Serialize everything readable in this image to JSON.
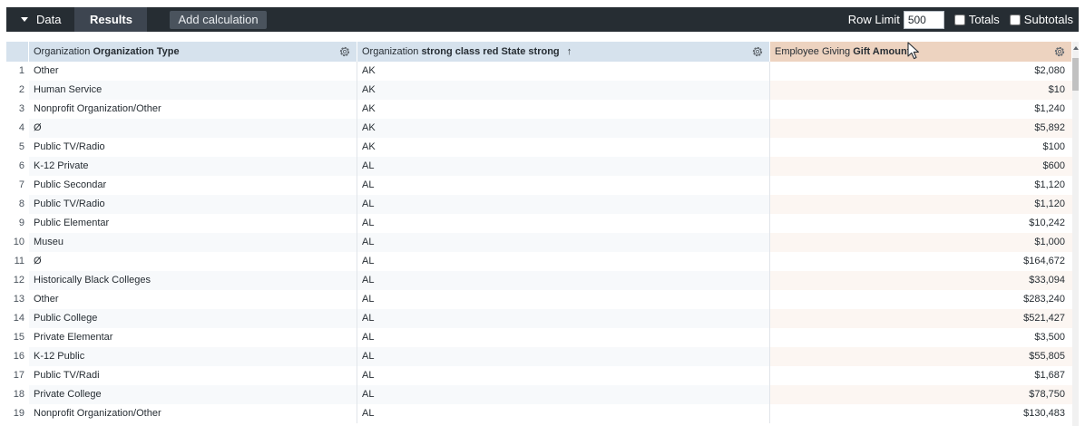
{
  "toolbar": {
    "data_tab": "Data",
    "results_tab": "Results",
    "add_calculation": "Add calculation",
    "row_limit_label": "Row Limit",
    "row_limit_value": "500",
    "totals_label": "Totals",
    "subtotals_label": "Subtotals"
  },
  "columns": {
    "col1": {
      "group": "Organization",
      "field": "Organization Type"
    },
    "col2": {
      "group": "Organization",
      "field": "strong class red State strong",
      "sort": "↑"
    },
    "col3": {
      "group": "Employee Giving",
      "field": "Gift Amount"
    }
  },
  "rows": [
    {
      "idx": "1",
      "type": "Other",
      "state": "AK",
      "amount": "$2,080"
    },
    {
      "idx": "2",
      "type": "Human Service",
      "state": "AK",
      "amount": "$10"
    },
    {
      "idx": "3",
      "type": "Nonprofit Organization/Other",
      "state": "AK",
      "amount": "$1,240"
    },
    {
      "idx": "4",
      "type": "Ø",
      "state": "AK",
      "amount": "$5,892"
    },
    {
      "idx": "5",
      "type": "Public TV/Radio",
      "state": "AK",
      "amount": "$100"
    },
    {
      "idx": "6",
      "type": "K-12 Private",
      "state": "AL",
      "amount": "$600"
    },
    {
      "idx": "7",
      "type": "Public Secondar",
      "state": "AL",
      "amount": "$1,120"
    },
    {
      "idx": "8",
      "type": "Public TV/Radio",
      "state": "AL",
      "amount": "$1,120"
    },
    {
      "idx": "9",
      "type": "Public Elementar",
      "state": "AL",
      "amount": "$10,242"
    },
    {
      "idx": "10",
      "type": "Museu",
      "state": "AL",
      "amount": "$1,000"
    },
    {
      "idx": "11",
      "type": "Ø",
      "state": "AL",
      "amount": "$164,672"
    },
    {
      "idx": "12",
      "type": "Historically Black Colleges",
      "state": "AL",
      "amount": "$33,094"
    },
    {
      "idx": "13",
      "type": "Other",
      "state": "AL",
      "amount": "$283,240"
    },
    {
      "idx": "14",
      "type": "Public College",
      "state": "AL",
      "amount": "$521,427"
    },
    {
      "idx": "15",
      "type": "Private Elementar",
      "state": "AL",
      "amount": "$3,500"
    },
    {
      "idx": "16",
      "type": "K-12 Public",
      "state": "AL",
      "amount": "$55,805"
    },
    {
      "idx": "17",
      "type": "Public TV/Radi",
      "state": "AL",
      "amount": "$1,687"
    },
    {
      "idx": "18",
      "type": "Private College",
      "state": "AL",
      "amount": "$78,750"
    },
    {
      "idx": "19",
      "type": "Nonprofit Organization/Other",
      "state": "AL",
      "amount": "$130,483"
    }
  ],
  "icons": {
    "dropdown": "caret-down-icon",
    "column_settings": "gear-icon",
    "sort": "sort-ascending-icon",
    "cursor": "mouse-pointer-icon"
  }
}
